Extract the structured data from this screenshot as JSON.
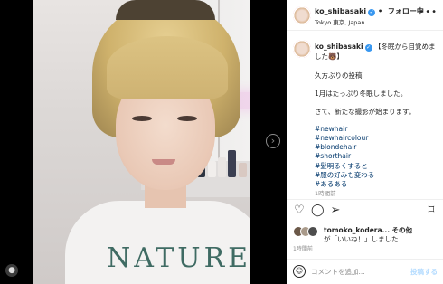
{
  "post": {
    "username": "ko_shibasaki",
    "follow_label": "フォロー中",
    "location": "Tokyo 東京, Japan",
    "more_icon": "more-dots-icon"
  },
  "photo": {
    "shirt_text": "NATURE",
    "next_icon": "chevron-right-icon"
  },
  "caption": {
    "username": "ko_shibasaki",
    "first_line": "【冬眠から目覚めました🐻】",
    "lines": [
      "久方ぶりの投稿",
      "1月はたっぷり冬眠しました。",
      "さて、新たな撮影が始まります。"
    ],
    "hashtags": [
      "#newhair",
      "#newhaircolour",
      "#blondehair",
      "#shorthair",
      "#髪明るくすると",
      "#服の好みも変わる",
      "#あるある"
    ],
    "time": "1時間前"
  },
  "likes": {
    "liker": "tomoko_kodera...",
    "others_label": "その他",
    "suffix": "が「いいね！」しました",
    "time": "1時間前"
  },
  "comment": {
    "placeholder": "コメントを追加...",
    "post_label": "投稿する"
  },
  "colors": {
    "link": "#00376b",
    "verified": "#3897f0",
    "post_button": "#b3dbff"
  }
}
